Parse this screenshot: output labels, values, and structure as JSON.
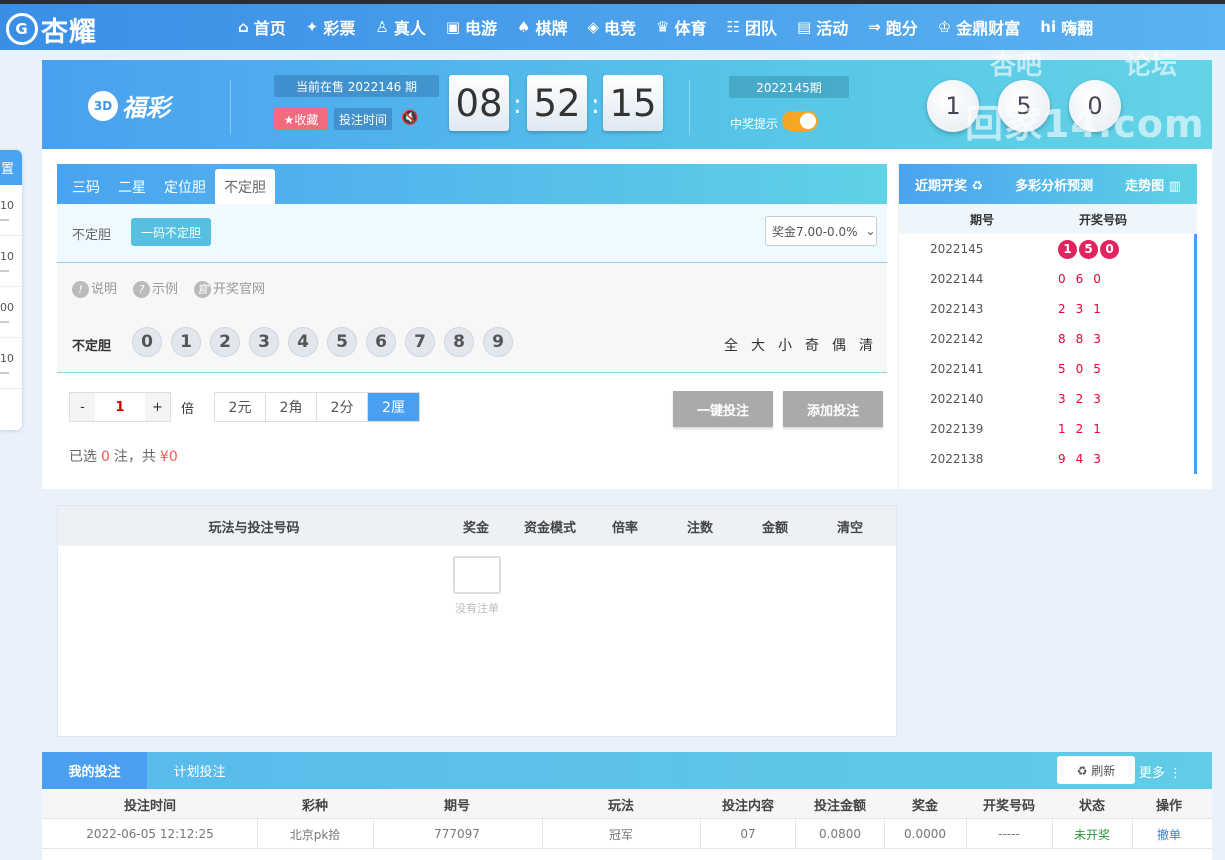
{
  "brand": {
    "name": "杏耀"
  },
  "nav": {
    "items": [
      {
        "label": "首页",
        "icon": "home-icon",
        "glyph": "⌂"
      },
      {
        "label": "彩票",
        "icon": "ticket-icon",
        "glyph": "✦"
      },
      {
        "label": "真人",
        "icon": "person-icon",
        "glyph": "♙"
      },
      {
        "label": "电游",
        "icon": "slot-machine-icon",
        "glyph": "▣"
      },
      {
        "label": "棋牌",
        "icon": "cards-icon",
        "glyph": "♠"
      },
      {
        "label": "电竞",
        "icon": "gamepad-icon",
        "glyph": "◈"
      },
      {
        "label": "体育",
        "icon": "trophy-icon",
        "glyph": "♛"
      },
      {
        "label": "团队",
        "icon": "team-icon",
        "glyph": "☷"
      },
      {
        "label": "活动",
        "icon": "gift-icon",
        "glyph": "▤"
      },
      {
        "label": "跑分",
        "icon": "car-icon",
        "glyph": "⇒"
      },
      {
        "label": "金鼎财富",
        "icon": "finance-icon",
        "glyph": "♔"
      },
      {
        "label": "嗨翻",
        "icon": "hi-icon",
        "glyph": "hi"
      }
    ]
  },
  "side": {
    "title": "置",
    "rows": [
      "10",
      "10",
      "00",
      "10"
    ]
  },
  "lottery": {
    "name": "福彩",
    "badge": "3D",
    "on_sale": "当前在售 2022146 期",
    "favorite": "★收藏",
    "bet_time": "投注时间",
    "timer": [
      "08",
      "52",
      "15"
    ],
    "last_issue": "2022145期",
    "win_hint": "中奖提示",
    "last_balls": [
      "1",
      "5",
      "0"
    ]
  },
  "watermark": {
    "t1": "杏吧",
    "t2": "论坛",
    "t3": "回家14.com"
  },
  "play": {
    "tabs": [
      "三码",
      "二星",
      "定位胆",
      "不定胆"
    ],
    "active_tab": 3,
    "sub_label": "不定胆",
    "sub_option": "一码不定胆",
    "prize": "奖金7.00-0.0%",
    "links": [
      "说明",
      "示例",
      "开奖官网"
    ],
    "number_label": "不定胆",
    "numbers": [
      "0",
      "1",
      "2",
      "3",
      "4",
      "5",
      "6",
      "7",
      "8",
      "9"
    ],
    "quick": [
      "全",
      "大",
      "小",
      "奇",
      "偶",
      "清"
    ],
    "multiple": "1",
    "bei": "倍",
    "units": [
      "2元",
      "2角",
      "2分",
      "2厘"
    ],
    "active_unit": 3,
    "one_click": "一键投注",
    "add_bet": "添加投注",
    "selected_prefix": "已选",
    "selected_count": "0",
    "selected_mid": "注，共",
    "selected_amount": "¥0"
  },
  "draws": {
    "tabs": [
      "近期开奖 ♻",
      "多彩分析预测",
      "走势图 ▥"
    ],
    "col_issue": "期号",
    "col_code": "开奖号码",
    "rows": [
      {
        "issue": "2022145",
        "code": [
          "1",
          "5",
          "0"
        ]
      },
      {
        "issue": "2022144",
        "code": [
          "0",
          "6",
          "0"
        ]
      },
      {
        "issue": "2022143",
        "code": [
          "2",
          "3",
          "1"
        ]
      },
      {
        "issue": "2022142",
        "code": [
          "8",
          "8",
          "3"
        ]
      },
      {
        "issue": "2022141",
        "code": [
          "5",
          "0",
          "5"
        ]
      },
      {
        "issue": "2022140",
        "code": [
          "3",
          "2",
          "3"
        ]
      },
      {
        "issue": "2022139",
        "code": [
          "1",
          "2",
          "1"
        ]
      },
      {
        "issue": "2022138",
        "code": [
          "9",
          "4",
          "3"
        ]
      }
    ]
  },
  "cart": {
    "columns": [
      "玩法与投注号码",
      "奖金",
      "资金模式",
      "倍率",
      "注数",
      "金额",
      "清空"
    ],
    "empty": "没有注单"
  },
  "mybets": {
    "tabs": [
      "我的投注",
      "计划投注"
    ],
    "refresh": "♻ 刷新",
    "more": "更多 ⋮",
    "columns": [
      "投注时间",
      "彩种",
      "期号",
      "玩法",
      "投注内容",
      "投注金额",
      "奖金",
      "开奖号码",
      "状态",
      "操作"
    ],
    "rows": [
      [
        "2022-06-05 12:12:25",
        "北京pk拾",
        "777097",
        "冠军",
        "07",
        "0.0800",
        "0.0000",
        "-----",
        "未开奖",
        "撤单"
      ]
    ]
  },
  "colors": {
    "accent": "#4a9ff0",
    "status_pending": "#2a9a3a",
    "action": "#3a7fd8",
    "number_red": "#e0245e"
  }
}
